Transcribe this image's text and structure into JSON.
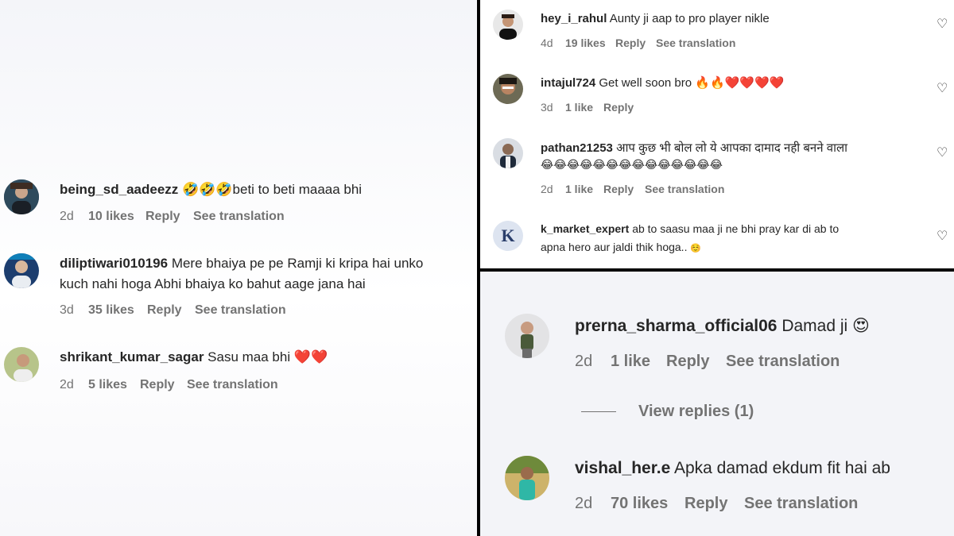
{
  "left_comments": [
    {
      "user": "being_sd_aadeezz",
      "emoji_pre": "🤣🤣🤣",
      "text": "beti to beti maaaa bhi",
      "time": "2d",
      "likes": "10 likes",
      "reply": "Reply",
      "translate": "See translation"
    },
    {
      "user": "diliptiwari010196",
      "text_line1": "Mere bhaiya pe pe Ramji ki kripa hai unko",
      "text_line2": "kuch nahi hoga Abhi bhaiya ko bahut aage jana hai",
      "time": "3d",
      "likes": "35 likes",
      "reply": "Reply",
      "translate": "See translation"
    },
    {
      "user": "shrikant_kumar_sagar",
      "text": "Sasu maa bhi",
      "emoji_post": "❤️❤️",
      "time": "2d",
      "likes": "5 likes",
      "reply": "Reply",
      "translate": "See translation"
    }
  ],
  "top_right_comments": [
    {
      "user": "hey_i_rahul",
      "text": "Aunty ji aap to pro player nikle",
      "time": "4d",
      "likes": "19 likes",
      "reply": "Reply",
      "translate": "See translation"
    },
    {
      "user": "intajul724",
      "text": "Get well soon bro",
      "emoji_post": "🔥🔥❤️❤️❤️❤️",
      "time": "3d",
      "likes": "1 like",
      "reply": "Reply"
    },
    {
      "user": "pathan21253",
      "text": "आप कुछ भी बोल लो ये आपका दामाद नही बनने वाला",
      "emoji_line2": "😂😂😂😂😂😂😂😂😂😂😂😂😂😂",
      "time": "2d",
      "likes": "1 like",
      "reply": "Reply",
      "translate": "See translation"
    },
    {
      "user": "k_market_expert",
      "text_line1": "ab to saasu maa ji ne bhi pray kar di ab to",
      "text_line2": "apna hero aur jaldi thik hoga..",
      "emoji_post": "☺️",
      "avatar_letter": "K"
    }
  ],
  "bottom_right_comments": [
    {
      "user": "prerna_sharma_official06",
      "text": "Damad ji",
      "emoji_post": "😍",
      "time": "2d",
      "likes": "1 like",
      "reply": "Reply",
      "translate": "See translation"
    },
    {
      "user": "vishal_her.e",
      "text": "Apka damad ekdum fit hai ab",
      "time": "2d",
      "likes": "70 likes",
      "reply": "Reply",
      "translate": "See translation"
    }
  ],
  "view_replies": "View replies (1)",
  "icons": {
    "like": "heart-outline-icon"
  },
  "colors": {
    "text": "#262626",
    "meta": "#737373",
    "divider": "#000000",
    "heart": "#ed1d24"
  }
}
